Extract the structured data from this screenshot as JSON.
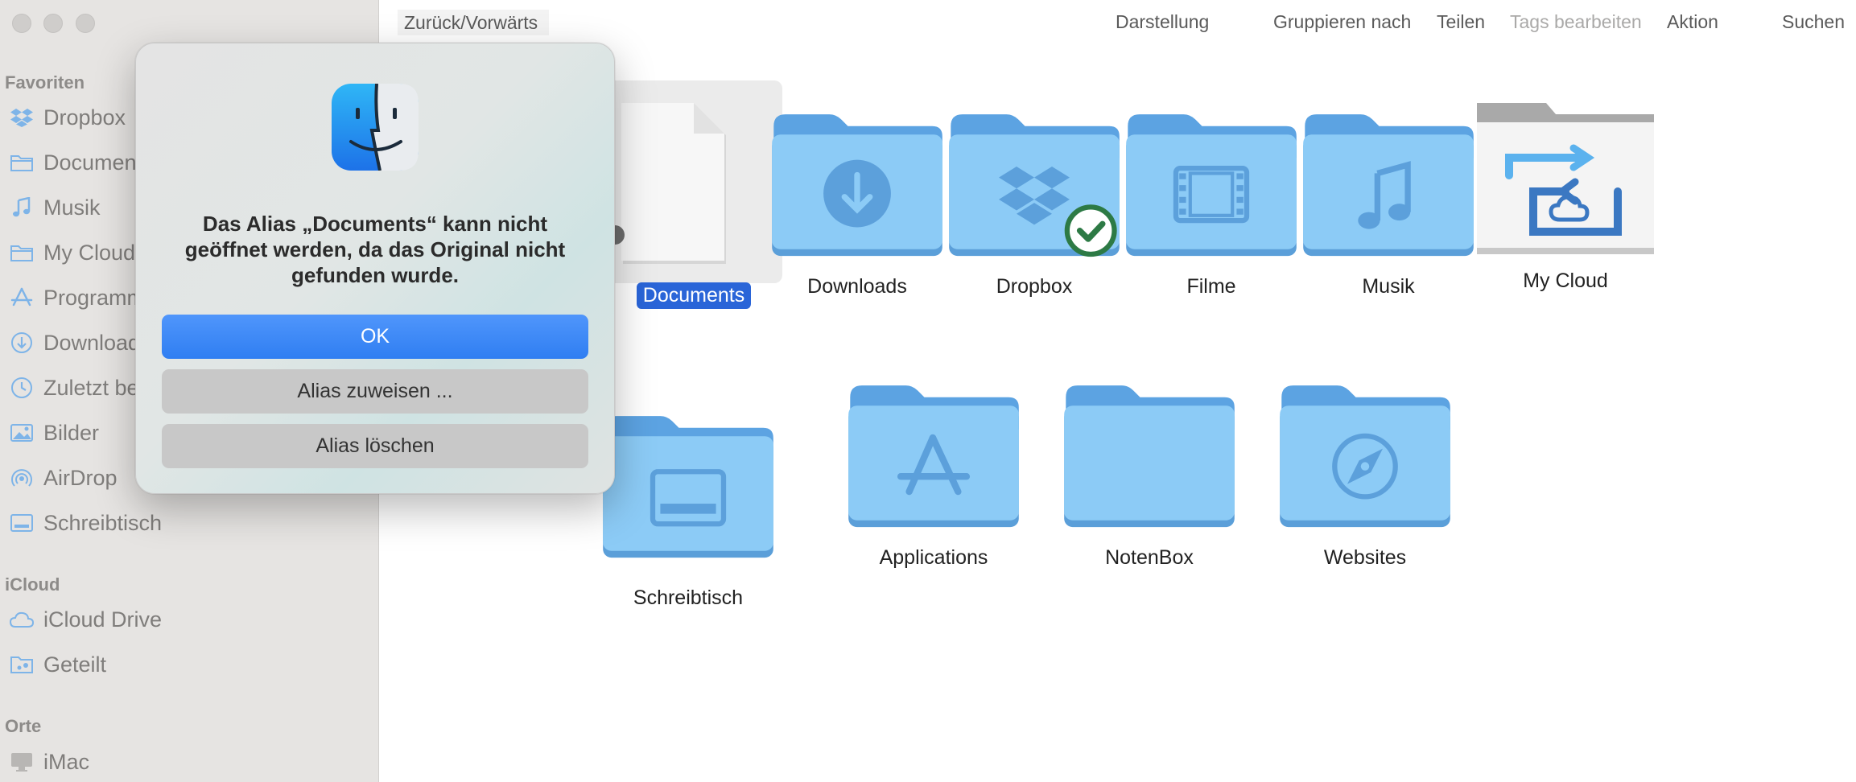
{
  "sidebar": {
    "sections": [
      {
        "title": "Favoriten",
        "items": [
          {
            "label": "Dropbox",
            "icon": "dropbox-icon"
          },
          {
            "label": "Documen",
            "icon": "folder-icon"
          },
          {
            "label": "Musik",
            "icon": "music-note-icon"
          },
          {
            "label": "My Cloud",
            "icon": "folder-icon"
          },
          {
            "label": "Programm",
            "icon": "app-store-icon"
          },
          {
            "label": "Download",
            "icon": "download-circle-icon"
          },
          {
            "label": "Zuletzt be",
            "icon": "clock-icon"
          },
          {
            "label": "Bilder",
            "icon": "photo-icon"
          },
          {
            "label": "AirDrop",
            "icon": "airdrop-icon"
          },
          {
            "label": "Schreibtisch",
            "icon": "desktop-icon"
          }
        ]
      },
      {
        "title": "iCloud",
        "items": [
          {
            "label": "iCloud Drive",
            "icon": "cloud-icon"
          },
          {
            "label": "Geteilt",
            "icon": "shared-folder-icon"
          }
        ]
      },
      {
        "title": "Orte",
        "items": [
          {
            "label": "iMac",
            "icon": "imac-icon"
          }
        ]
      }
    ]
  },
  "toolbar": {
    "back_forward": "Zurück/Vorwärts",
    "view": "Darstellung",
    "group_by": "Gruppieren nach",
    "share": "Teilen",
    "edit_tags": "Tags bearbeiten",
    "action": "Aktion",
    "search": "Suchen"
  },
  "files": [
    {
      "label": "Documents",
      "icon": "alias-document-icon",
      "selected": true
    },
    {
      "label": "Downloads",
      "icon": "downloads-folder-icon"
    },
    {
      "label": "Dropbox",
      "icon": "dropbox-folder-icon"
    },
    {
      "label": "Filme",
      "icon": "movies-folder-icon"
    },
    {
      "label": "Musik",
      "icon": "music-folder-icon"
    },
    {
      "label": "My Cloud",
      "icon": "my-cloud-folder-icon"
    },
    {
      "label": "Schreibtisch",
      "icon": "desktop-folder-icon"
    },
    {
      "label": "Applications",
      "icon": "applications-folder-icon"
    },
    {
      "label": "NotenBox",
      "icon": "folder-icon"
    },
    {
      "label": "Websites",
      "icon": "websites-folder-icon"
    }
  ],
  "dialog": {
    "icon": "finder-icon",
    "message": "Das Alias „Documents“ kann nicht geöffnet werden, da das Original nicht gefunden wurde.",
    "ok": "OK",
    "reassign": "Alias zuweisen ...",
    "delete": "Alias löschen"
  },
  "colors": {
    "folder_body": "#8ac8f5",
    "folder_tab": "#5ca3e2",
    "folder_glyph": "#5ca0db",
    "selection": "#2a65d8",
    "primary_button": "#3a86f6",
    "sync_check": "#2d7a45"
  }
}
